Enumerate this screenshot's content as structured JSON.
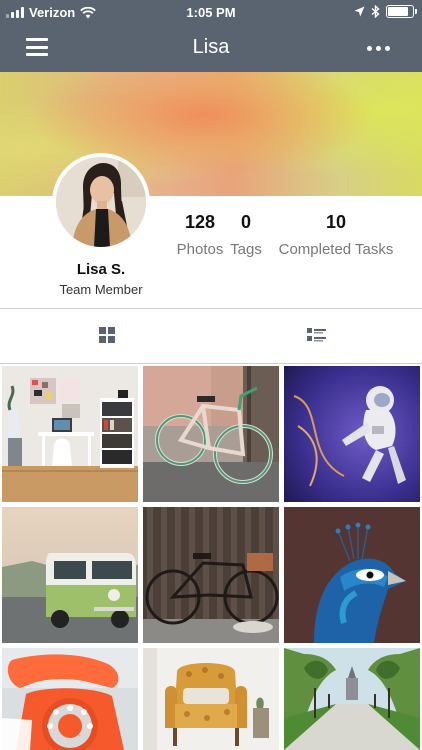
{
  "status_bar": {
    "carrier": "Verizon",
    "time": "1:05 PM",
    "battery_level": 0.9
  },
  "nav": {
    "title": "Lisa",
    "left_icon": "hamburger-menu-icon",
    "right_icon": "more-horizontal-icon"
  },
  "profile": {
    "name": "Lisa S.",
    "role": "Team Member"
  },
  "stats": [
    {
      "value": "128",
      "label": "Photos"
    },
    {
      "value": "0",
      "label": "Tags"
    },
    {
      "value": "10",
      "label": "Completed Tasks"
    }
  ],
  "view_toggle": {
    "grid_icon": "grid-view-icon",
    "list_icon": "list-view-icon",
    "active": "grid"
  },
  "photos": [
    {
      "subject": "workspace desk"
    },
    {
      "subject": "pink bicycle"
    },
    {
      "subject": "astronaut"
    },
    {
      "subject": "green vw van"
    },
    {
      "subject": "bicycle by wooden wall"
    },
    {
      "subject": "peacock"
    },
    {
      "subject": "red telephone"
    },
    {
      "subject": "floral armchair"
    },
    {
      "subject": "tree lined path"
    }
  ],
  "colors": {
    "nav_bg": "#5a6470",
    "text_muted": "#777777",
    "divider": "#cfcfcf"
  }
}
